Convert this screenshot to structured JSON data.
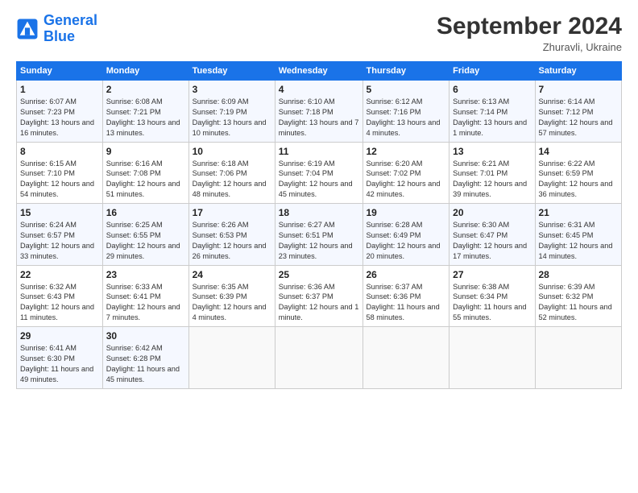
{
  "logo": {
    "line1": "General",
    "line2": "Blue"
  },
  "title": "September 2024",
  "subtitle": "Zhuravli, Ukraine",
  "days_header": [
    "Sunday",
    "Monday",
    "Tuesday",
    "Wednesday",
    "Thursday",
    "Friday",
    "Saturday"
  ],
  "weeks": [
    [
      {
        "day": "1",
        "sunrise": "6:07 AM",
        "sunset": "7:23 PM",
        "daylight": "13 hours and 16 minutes."
      },
      {
        "day": "2",
        "sunrise": "6:08 AM",
        "sunset": "7:21 PM",
        "daylight": "13 hours and 13 minutes."
      },
      {
        "day": "3",
        "sunrise": "6:09 AM",
        "sunset": "7:19 PM",
        "daylight": "13 hours and 10 minutes."
      },
      {
        "day": "4",
        "sunrise": "6:10 AM",
        "sunset": "7:18 PM",
        "daylight": "13 hours and 7 minutes."
      },
      {
        "day": "5",
        "sunrise": "6:12 AM",
        "sunset": "7:16 PM",
        "daylight": "13 hours and 4 minutes."
      },
      {
        "day": "6",
        "sunrise": "6:13 AM",
        "sunset": "7:14 PM",
        "daylight": "13 hours and 1 minute."
      },
      {
        "day": "7",
        "sunrise": "6:14 AM",
        "sunset": "7:12 PM",
        "daylight": "12 hours and 57 minutes."
      }
    ],
    [
      {
        "day": "8",
        "sunrise": "6:15 AM",
        "sunset": "7:10 PM",
        "daylight": "12 hours and 54 minutes."
      },
      {
        "day": "9",
        "sunrise": "6:16 AM",
        "sunset": "7:08 PM",
        "daylight": "12 hours and 51 minutes."
      },
      {
        "day": "10",
        "sunrise": "6:18 AM",
        "sunset": "7:06 PM",
        "daylight": "12 hours and 48 minutes."
      },
      {
        "day": "11",
        "sunrise": "6:19 AM",
        "sunset": "7:04 PM",
        "daylight": "12 hours and 45 minutes."
      },
      {
        "day": "12",
        "sunrise": "6:20 AM",
        "sunset": "7:02 PM",
        "daylight": "12 hours and 42 minutes."
      },
      {
        "day": "13",
        "sunrise": "6:21 AM",
        "sunset": "7:01 PM",
        "daylight": "12 hours and 39 minutes."
      },
      {
        "day": "14",
        "sunrise": "6:22 AM",
        "sunset": "6:59 PM",
        "daylight": "12 hours and 36 minutes."
      }
    ],
    [
      {
        "day": "15",
        "sunrise": "6:24 AM",
        "sunset": "6:57 PM",
        "daylight": "12 hours and 33 minutes."
      },
      {
        "day": "16",
        "sunrise": "6:25 AM",
        "sunset": "6:55 PM",
        "daylight": "12 hours and 29 minutes."
      },
      {
        "day": "17",
        "sunrise": "6:26 AM",
        "sunset": "6:53 PM",
        "daylight": "12 hours and 26 minutes."
      },
      {
        "day": "18",
        "sunrise": "6:27 AM",
        "sunset": "6:51 PM",
        "daylight": "12 hours and 23 minutes."
      },
      {
        "day": "19",
        "sunrise": "6:28 AM",
        "sunset": "6:49 PM",
        "daylight": "12 hours and 20 minutes."
      },
      {
        "day": "20",
        "sunrise": "6:30 AM",
        "sunset": "6:47 PM",
        "daylight": "12 hours and 17 minutes."
      },
      {
        "day": "21",
        "sunrise": "6:31 AM",
        "sunset": "6:45 PM",
        "daylight": "12 hours and 14 minutes."
      }
    ],
    [
      {
        "day": "22",
        "sunrise": "6:32 AM",
        "sunset": "6:43 PM",
        "daylight": "12 hours and 11 minutes."
      },
      {
        "day": "23",
        "sunrise": "6:33 AM",
        "sunset": "6:41 PM",
        "daylight": "12 hours and 7 minutes."
      },
      {
        "day": "24",
        "sunrise": "6:35 AM",
        "sunset": "6:39 PM",
        "daylight": "12 hours and 4 minutes."
      },
      {
        "day": "25",
        "sunrise": "6:36 AM",
        "sunset": "6:37 PM",
        "daylight": "12 hours and 1 minute."
      },
      {
        "day": "26",
        "sunrise": "6:37 AM",
        "sunset": "6:36 PM",
        "daylight": "11 hours and 58 minutes."
      },
      {
        "day": "27",
        "sunrise": "6:38 AM",
        "sunset": "6:34 PM",
        "daylight": "11 hours and 55 minutes."
      },
      {
        "day": "28",
        "sunrise": "6:39 AM",
        "sunset": "6:32 PM",
        "daylight": "11 hours and 52 minutes."
      }
    ],
    [
      {
        "day": "29",
        "sunrise": "6:41 AM",
        "sunset": "6:30 PM",
        "daylight": "11 hours and 49 minutes."
      },
      {
        "day": "30",
        "sunrise": "6:42 AM",
        "sunset": "6:28 PM",
        "daylight": "11 hours and 45 minutes."
      },
      null,
      null,
      null,
      null,
      null
    ]
  ]
}
